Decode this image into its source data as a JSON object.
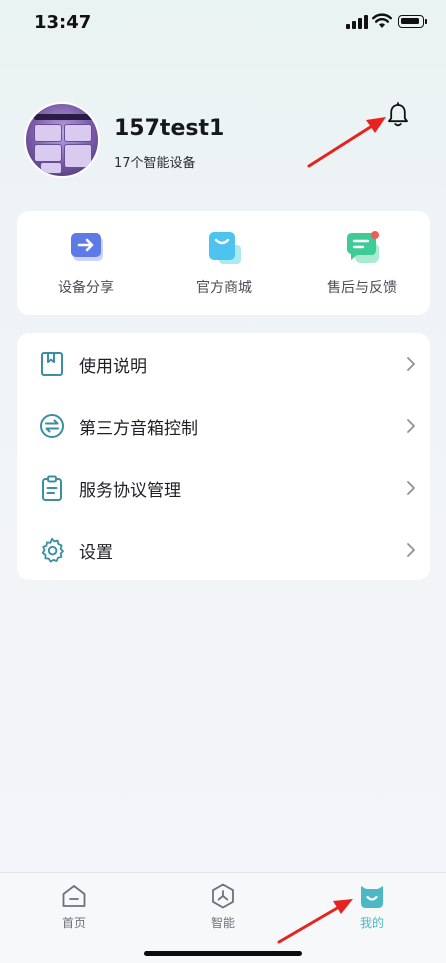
{
  "status_bar": {
    "time": "13:47"
  },
  "profile": {
    "name": "157test1",
    "subtitle": "17个智能设备"
  },
  "quick_actions": [
    {
      "label": "设备分享",
      "icon": "share-device-icon"
    },
    {
      "label": "官方商城",
      "icon": "shopping-bag-icon"
    },
    {
      "label": "售后与反馈",
      "icon": "feedback-chat-icon"
    }
  ],
  "menu": [
    {
      "label": "使用说明",
      "icon": "bookmark-book-icon"
    },
    {
      "label": "第三方音箱控制",
      "icon": "swap-arrows-icon"
    },
    {
      "label": "服务协议管理",
      "icon": "clipboard-icon"
    },
    {
      "label": "设置",
      "icon": "gear-icon"
    }
  ],
  "tabs": [
    {
      "label": "首页",
      "icon": "home-icon",
      "active": false
    },
    {
      "label": "智能",
      "icon": "smart-hexagon-icon",
      "active": false
    },
    {
      "label": "我的",
      "icon": "mine-smile-icon",
      "active": true
    }
  ],
  "colors": {
    "accent": "#4db8c4",
    "annotation": "#e8231f",
    "menu_icon": "#3a8fa0"
  }
}
